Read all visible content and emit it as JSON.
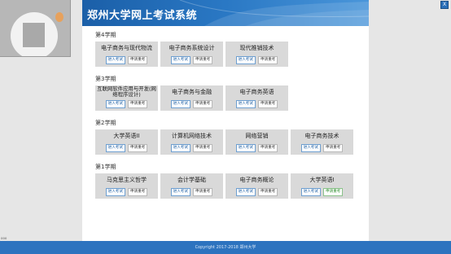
{
  "app": {
    "title": "郑州大学网上考试系统",
    "close_label": "X"
  },
  "photo": {
    "side_text": "ooo"
  },
  "terms": [
    {
      "label": "第4学期",
      "courses": [
        {
          "name": "电子商务与现代物流",
          "enter": "进入考试",
          "reapply": "申请重考"
        },
        {
          "name": "电子商务系统设计",
          "enter": "进入考试",
          "reapply": "申请重考"
        },
        {
          "name": "现代推销技术",
          "enter": "进入考试",
          "reapply": "申请重考"
        }
      ]
    },
    {
      "label": "第3学期",
      "courses": [
        {
          "name": "互联网软件应用与开发(网络程序设计)",
          "enter": "进入考试",
          "reapply": "申请重考"
        },
        {
          "name": "电子商务与金融",
          "enter": "进入考试",
          "reapply": "申请重考"
        },
        {
          "name": "电子商务英语",
          "enter": "进入考试",
          "reapply": "申请重考"
        }
      ]
    },
    {
      "label": "第2学期",
      "courses": [
        {
          "name": "大学英语II",
          "enter": "进入考试",
          "reapply": "申请重考"
        },
        {
          "name": "计算机网络技术",
          "enter": "进入考试",
          "reapply": "申请重考"
        },
        {
          "name": "网络营销",
          "enter": "进入考试",
          "reapply": "申请重考"
        },
        {
          "name": "电子商务技术",
          "enter": "进入考试",
          "reapply": "申请重考"
        }
      ]
    },
    {
      "label": "第1学期",
      "courses": [
        {
          "name": "马克思主义哲学",
          "enter": "进入考试",
          "reapply": "申请重考"
        },
        {
          "name": "会计学基础",
          "enter": "进入考试",
          "reapply": "申请重考"
        },
        {
          "name": "电子商务概论",
          "enter": "进入考试",
          "reapply": "申请重考"
        },
        {
          "name": "大学英语I",
          "enter": "进入考试",
          "reapply": "申请重考"
        }
      ]
    }
  ],
  "footer": {
    "copyright": "Copyright 2017-2018 郑州大学"
  },
  "colors": {
    "header_blue": "#2a78c4",
    "footer_blue": "#2d73bf",
    "card_gray": "#d9d9d9",
    "page_bg": "#e6e6e6"
  }
}
